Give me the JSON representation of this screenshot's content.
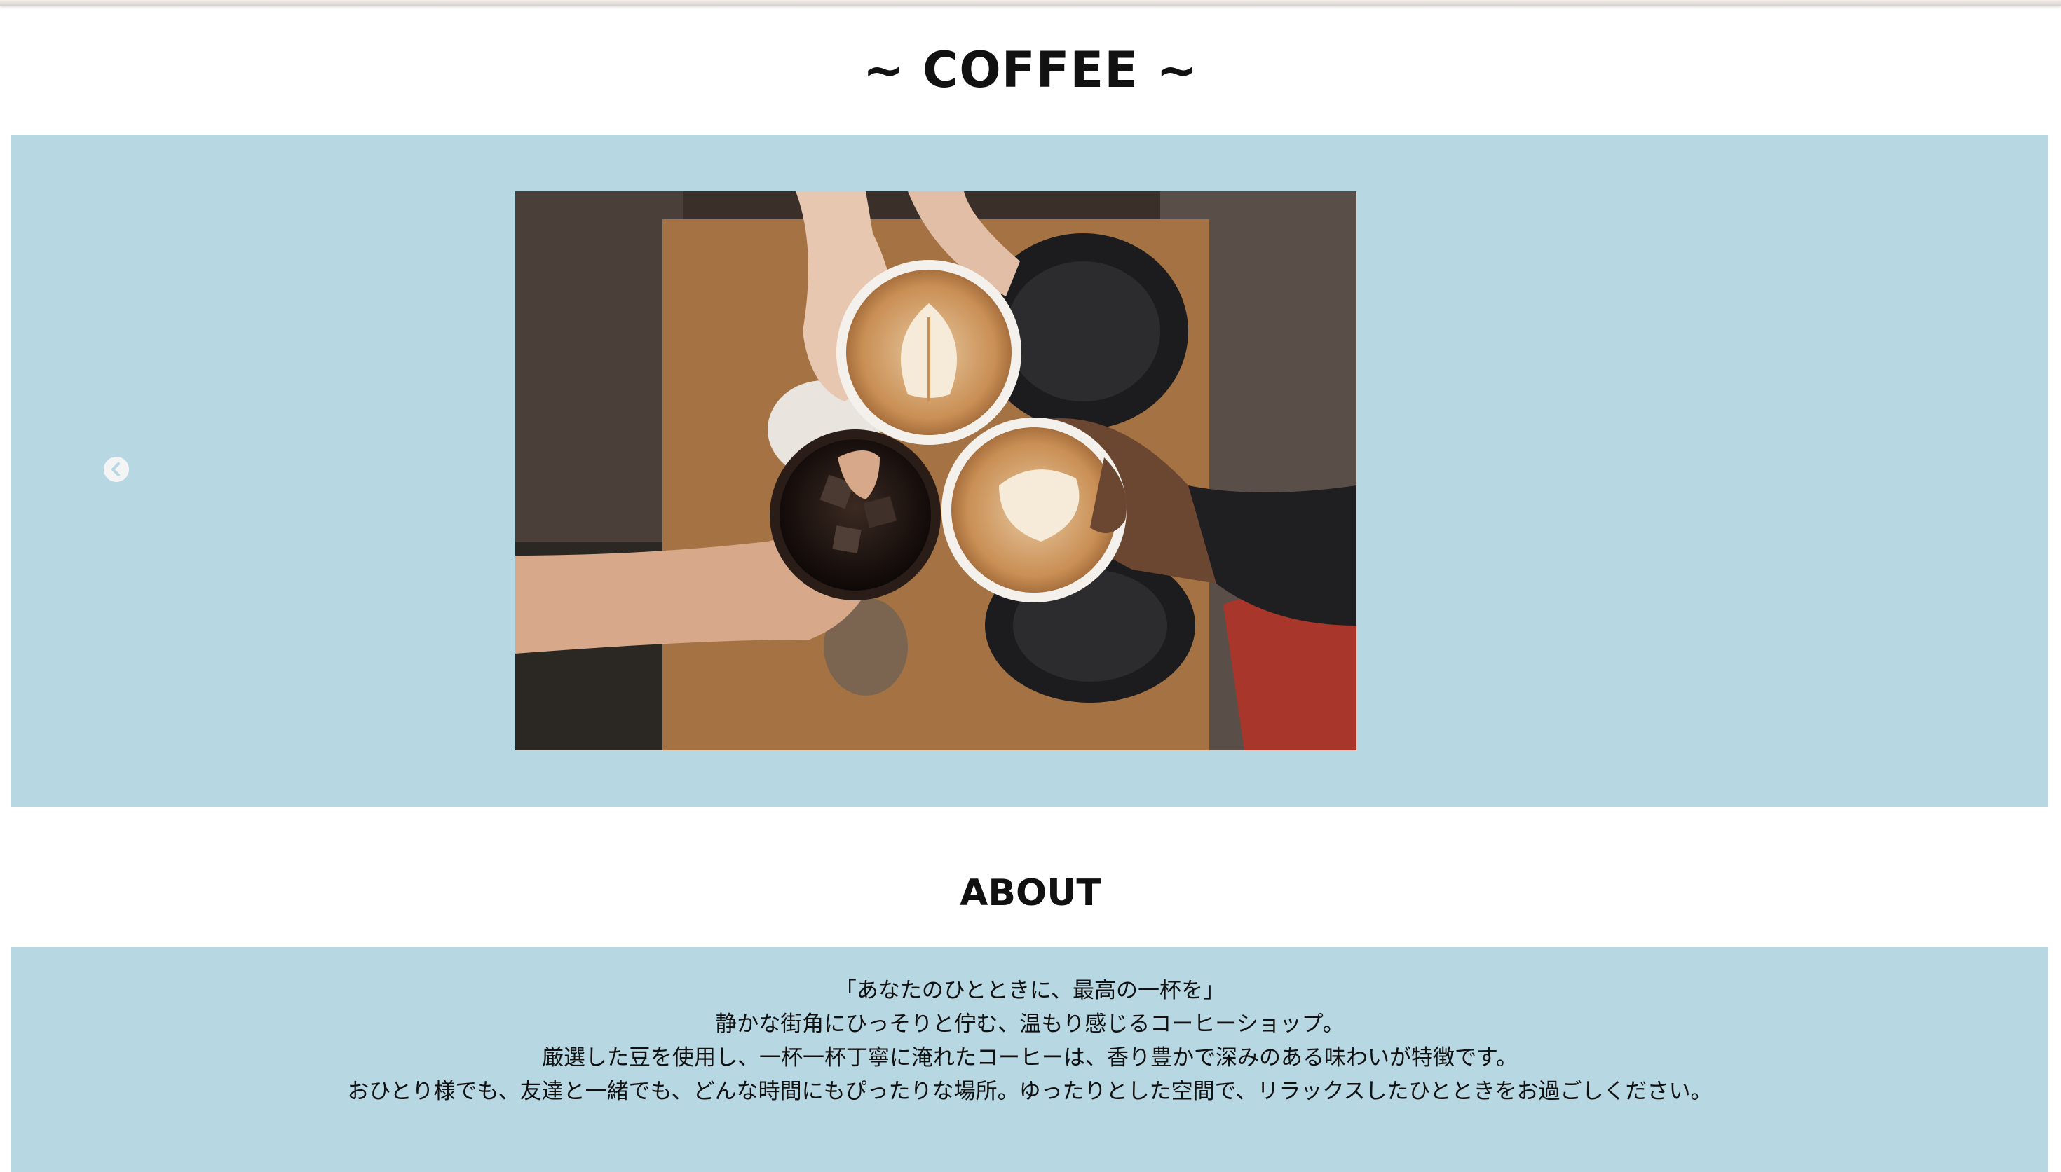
{
  "header": {
    "title": "~ COFFEE ~"
  },
  "carousel": {
    "prev_icon": "chevron-left-circle-icon",
    "image_description_icon": "coffee-photo"
  },
  "about": {
    "heading": "ABOUT",
    "lines": [
      "「あなたのひとときに、最高の一杯を」",
      "静かな街角にひっそりと佇む、温もり感じるコーヒーショップ。",
      "厳選した豆を使用し、一杯一杯丁寧に淹れたコーヒーは、香り豊かで深みのある味わいが特徴です。",
      "おひとり様でも、友達と一緒でも、どんな時間にもぴったりな場所。ゆったりとした空間で、リラックスしたひとときをお過ごしください。"
    ]
  },
  "colors": {
    "accent_panel": "#b7d7e3",
    "background": "#ffffff",
    "text": "#111111"
  }
}
